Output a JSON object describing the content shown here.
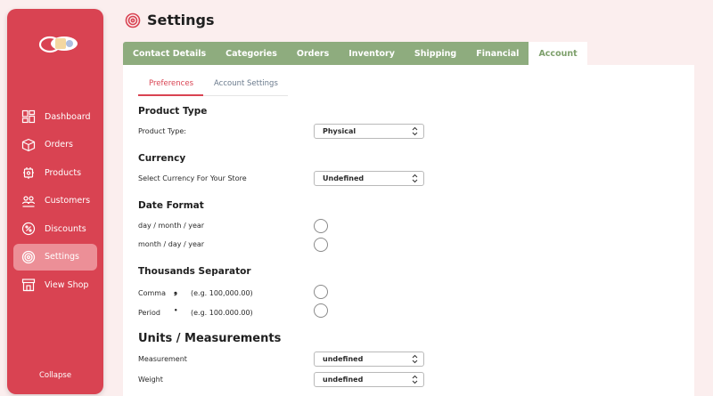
{
  "app": {
    "title": "Settings"
  },
  "sidebar": {
    "items": [
      {
        "label": "Dashboard",
        "icon": "dashboard-icon"
      },
      {
        "label": "Orders",
        "icon": "box-icon"
      },
      {
        "label": "Products",
        "icon": "product-icon"
      },
      {
        "label": "Customers",
        "icon": "customers-icon"
      },
      {
        "label": "Discounts",
        "icon": "discount-icon"
      },
      {
        "label": "Settings",
        "icon": "settings-icon",
        "active": true
      },
      {
        "label": "View Shop",
        "icon": "shop-icon"
      }
    ],
    "collapse_label": "Collapse"
  },
  "tabs": [
    {
      "label": "Contact Details"
    },
    {
      "label": "Categories"
    },
    {
      "label": "Orders"
    },
    {
      "label": "Inventory"
    },
    {
      "label": "Shipping"
    },
    {
      "label": "Financial"
    },
    {
      "label": "Account",
      "active": true
    }
  ],
  "subtabs": [
    {
      "label": "Preferences",
      "active": true
    },
    {
      "label": "Account Settings"
    }
  ],
  "sections": {
    "product_type": {
      "title": "Product Type",
      "label": "Product Type:",
      "value": "Physical"
    },
    "currency": {
      "title": "Currency",
      "label": "Select Currency For Your Store",
      "value": "Undefined"
    },
    "date_format": {
      "title": "Date Format",
      "options": [
        "day / month / year",
        "month / day / year"
      ]
    },
    "thousands_separator": {
      "title": "Thousands Separator",
      "options": [
        {
          "label": "Comma",
          "glyph": "❟",
          "example": "(e.g. 100,000.00)"
        },
        {
          "label": "Period",
          "glyph": "•",
          "example": "(e.g. 100.000.00)"
        }
      ]
    },
    "units": {
      "title": "Units / Measurements",
      "measurement_label": "Measurement",
      "measurement_value": "undefined",
      "weight_label": "Weight",
      "weight_value": "undefined"
    }
  },
  "colors": {
    "sidebar": "#d94352",
    "sidebar_active": "#ec8f97",
    "tab": "#8eac7e",
    "accent": "#d94352",
    "background": "#fbeeee"
  }
}
